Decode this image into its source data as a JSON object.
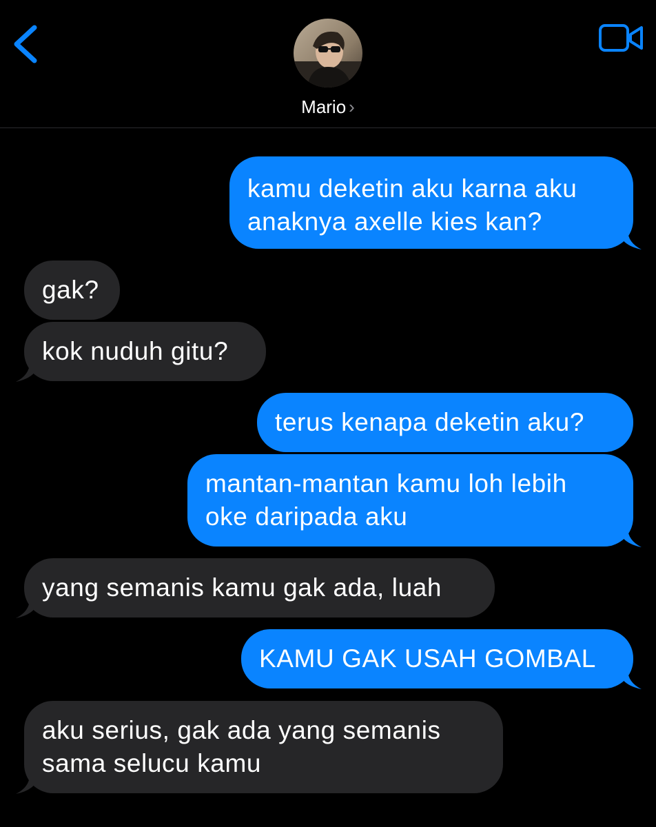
{
  "header": {
    "contact_name": "Mario",
    "chevron": "›",
    "back_icon": "chevron-left-icon",
    "video_icon": "video-camera-icon",
    "accent_color": "#0a84ff"
  },
  "messages": [
    {
      "direction": "sent",
      "text": "kamu deketin aku karna aku anaknya axelle kies kan?"
    },
    {
      "direction": "received",
      "text": "gak?"
    },
    {
      "direction": "received",
      "text": "kok nuduh gitu?"
    },
    {
      "direction": "sent",
      "text": "terus kenapa deketin aku?"
    },
    {
      "direction": "sent",
      "text": "mantan-mantan kamu loh lebih oke daripada aku"
    },
    {
      "direction": "received",
      "text": "yang semanis kamu gak ada, luah"
    },
    {
      "direction": "sent",
      "text": "KAMU GAK USAH GOMBAL"
    },
    {
      "direction": "received",
      "text": "aku serius, gak ada yang semanis sama selucu kamu"
    }
  ],
  "colors": {
    "sent_bubble": "#0a84ff",
    "received_bubble": "#262628",
    "background": "#000000"
  }
}
